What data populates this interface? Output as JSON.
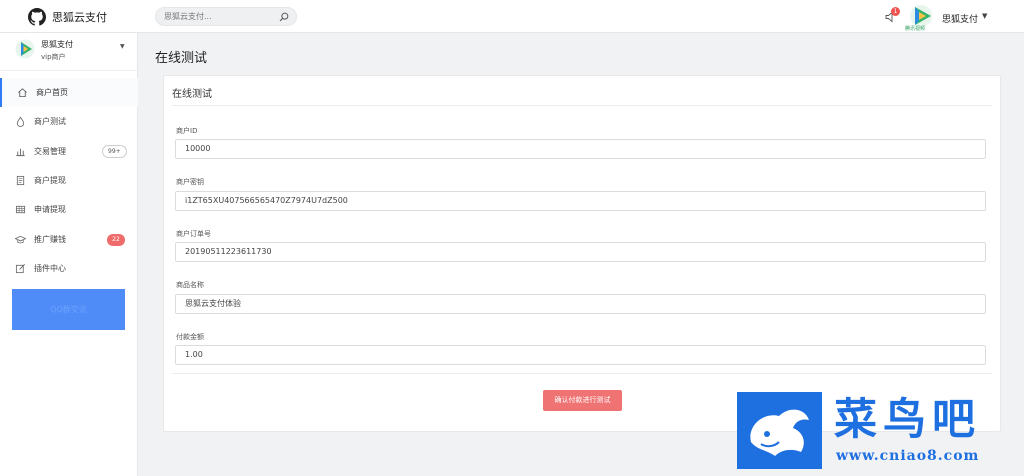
{
  "app": {
    "brand_name": "思狐云支付"
  },
  "search": {
    "placeholder": "思狐云支付..."
  },
  "header": {
    "notification_count": "1",
    "avatar_caption": "腾讯视频",
    "user_name": "思狐支付"
  },
  "sidebar": {
    "account": {
      "name": "思狐支付",
      "level": "vip商户"
    },
    "items": [
      {
        "label": "商户首页",
        "icon": "home-icon"
      },
      {
        "label": "商户测试",
        "icon": "drop-icon"
      },
      {
        "label": "交易管理",
        "icon": "bar-chart-icon",
        "badge": "99+"
      },
      {
        "label": "商户提现",
        "icon": "document-icon"
      },
      {
        "label": "申请提现",
        "icon": "table-icon"
      },
      {
        "label": "推广赚钱",
        "icon": "graduation-cap-icon",
        "badge": "22"
      },
      {
        "label": "插件中心",
        "icon": "edit-icon"
      }
    ],
    "promo_button": "QQ群交流"
  },
  "main": {
    "page_title": "在线测试",
    "card_title": "在线测试",
    "fields": [
      {
        "label": "商户ID",
        "value": "10000"
      },
      {
        "label": "商户密钥",
        "value": "i1ZT65XU407566565470Z7974U7dZ500"
      },
      {
        "label": "商户订单号",
        "value": "20190511223611730"
      },
      {
        "label": "商品名称",
        "value": "思狐云支付体验"
      },
      {
        "label": "付款金额",
        "value": "1.00"
      }
    ],
    "submit_label": "确认付款进行测试"
  },
  "watermark": {
    "title": "菜鸟吧",
    "url": "www.cniao8.com"
  },
  "colors": {
    "accent": "#2f7cf6",
    "danger": "#ef7373",
    "sidebar_button": "#4f8cf7",
    "watermark": "#1e6fe0"
  }
}
